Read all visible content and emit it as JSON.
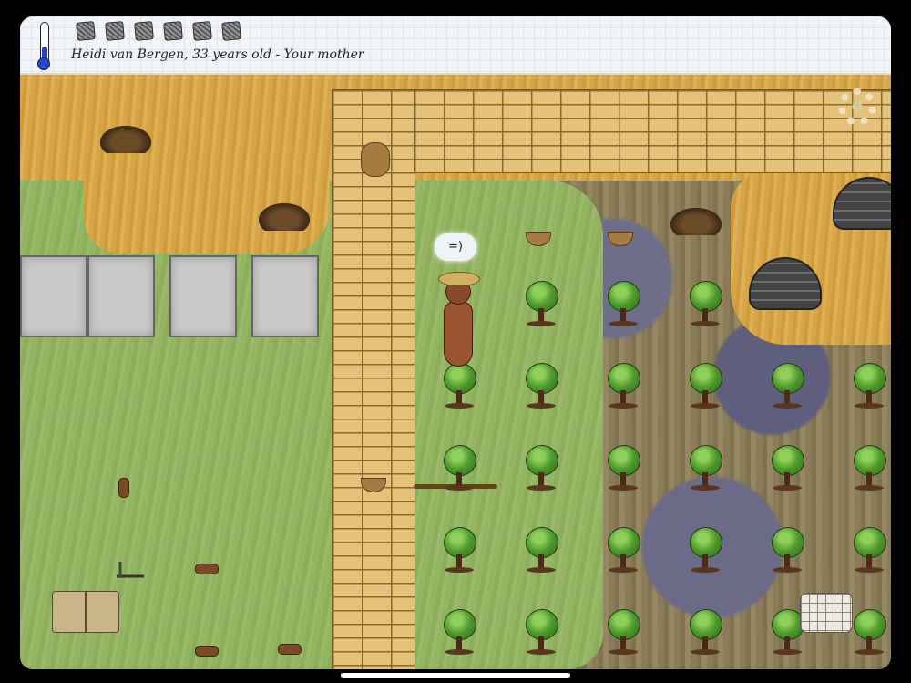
{
  "hud": {
    "temperature_level": 0.4,
    "food_pips_total": 6,
    "food_pips_filled": 6,
    "status_text": "Heidi van Bergen, 33 years old - Your mother"
  },
  "speech_bubble": {
    "text": "=)"
  },
  "icons": {
    "settings": "gear-icon",
    "keyboard": "keyboard-icon",
    "recipe_book": "book-icon"
  }
}
